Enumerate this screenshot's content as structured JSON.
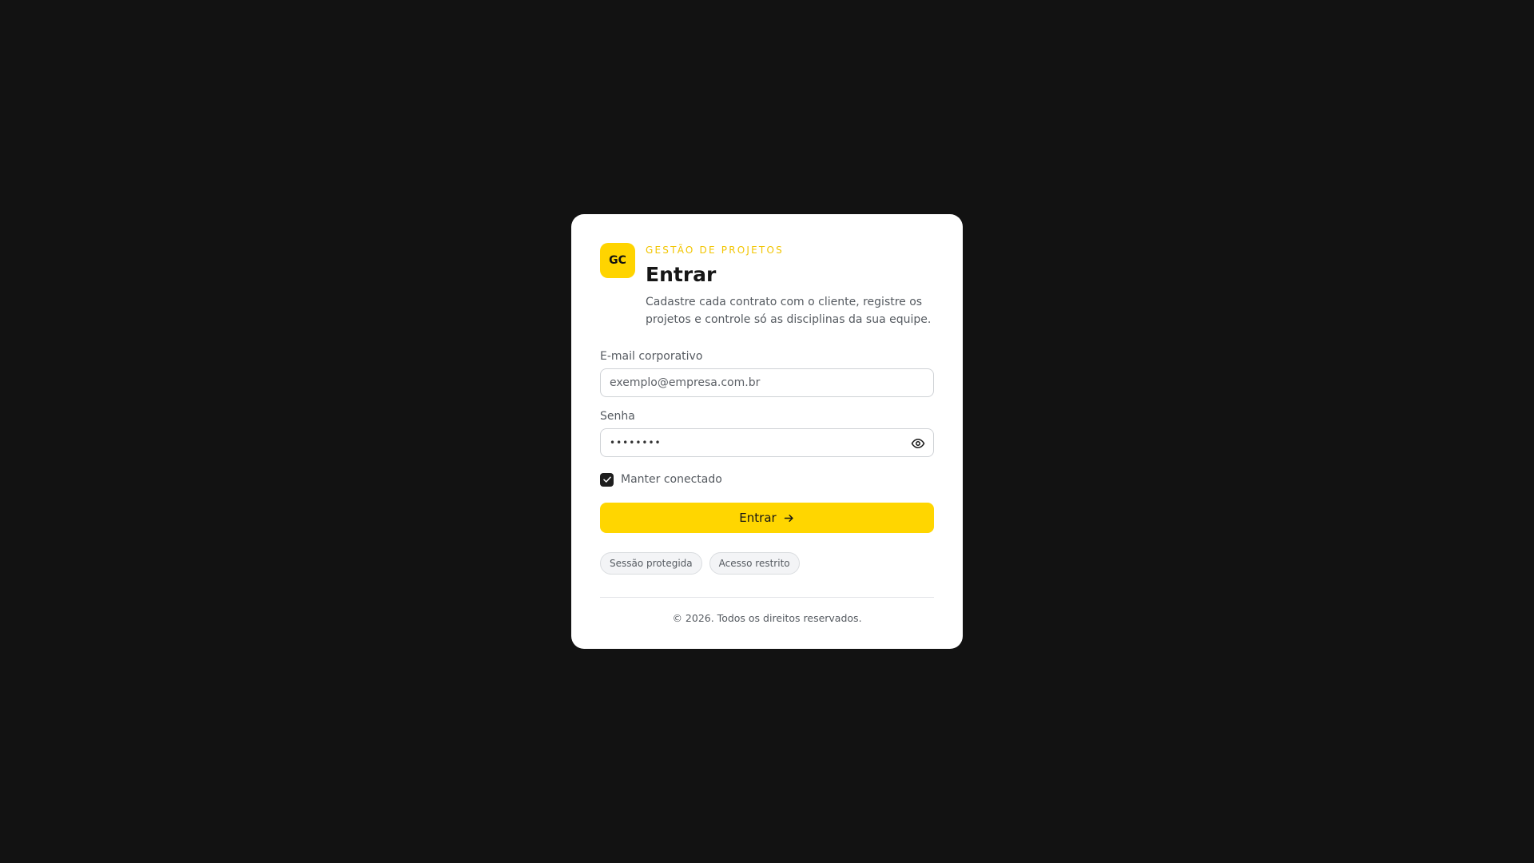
{
  "brand": {
    "logo_text": "GC",
    "eyebrow": "GESTÃO DE PROJETOS",
    "accent_color": "#FFD600"
  },
  "login": {
    "title": "Entrar",
    "description": "Cadastre cada contrato com o cliente, registre os projetos e controle só as disciplinas da sua equipe.",
    "email": {
      "label": "E-mail corporativo",
      "placeholder": "exemplo@empresa.com.br",
      "value": ""
    },
    "password": {
      "label": "Senha",
      "value": "••••••••",
      "toggle_icon": "eye-icon"
    },
    "remember": {
      "label": "Manter conectado",
      "checked": true
    },
    "submit_label": "Entrar",
    "submit_icon": "arrow-right-icon"
  },
  "chips": [
    "Sessão protegida",
    "Acesso restrito"
  ],
  "footer": {
    "copyright": "© 2026. Todos os direitos reservados."
  }
}
